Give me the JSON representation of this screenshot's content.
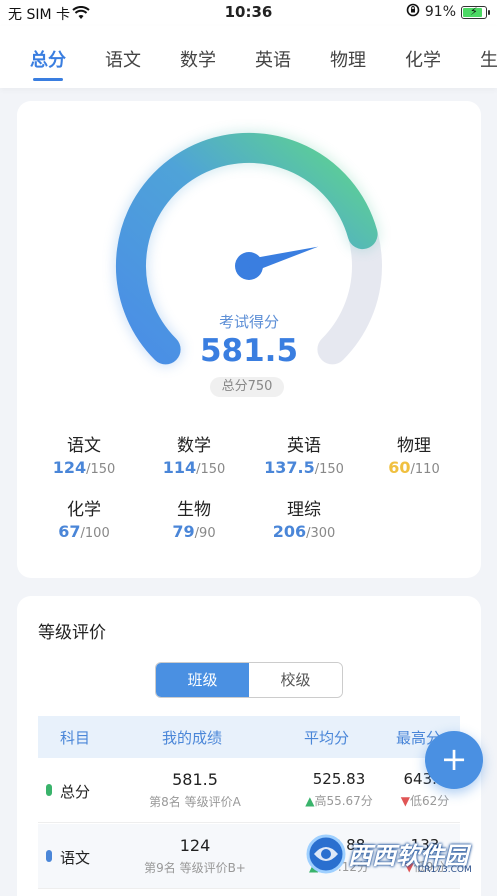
{
  "status_bar": {
    "carrier": "无 SIM 卡",
    "time": "10:36",
    "battery": "91%",
    "icons": [
      "wifi-icon",
      "orientation-lock-icon",
      "battery-icon"
    ]
  },
  "tabs": [
    {
      "label": "总分",
      "active": true
    },
    {
      "label": "语文",
      "active": false
    },
    {
      "label": "数学",
      "active": false
    },
    {
      "label": "英语",
      "active": false
    },
    {
      "label": "物理",
      "active": false
    },
    {
      "label": "化学",
      "active": false
    },
    {
      "label": "生",
      "active": false
    }
  ],
  "score_card": {
    "gauge_title": "考试得分",
    "score": "581.5",
    "score_value": 581.5,
    "total": "总分750",
    "total_value": 750,
    "subjects": [
      {
        "name": "语文",
        "score": "124",
        "max": "/150"
      },
      {
        "name": "数学",
        "score": "114",
        "max": "/150"
      },
      {
        "name": "英语",
        "score": "137.5",
        "max": "/150"
      },
      {
        "name": "物理",
        "score": "60",
        "max": "/110"
      },
      {
        "name": "化学",
        "score": "67",
        "max": "/100"
      },
      {
        "name": "生物",
        "score": "79",
        "max": "/90"
      },
      {
        "name": "理综",
        "score": "206",
        "max": "/300"
      }
    ]
  },
  "grade_card": {
    "title": "等级评价",
    "segments": [
      {
        "label": "班级",
        "active": true
      },
      {
        "label": "校级",
        "active": false
      }
    ],
    "columns": [
      "科目",
      "我的成绩",
      "平均分",
      "最高分"
    ],
    "rows": [
      {
        "subject": "总分",
        "score": "581.5",
        "rank": "第8名 等级评价A",
        "avg": "525.83",
        "avg_delta": "高55.67分",
        "max": "643.5",
        "max_delta": "低62分"
      },
      {
        "subject": "语文",
        "score": "124",
        "rank": "第9名 等级评价B+",
        "avg": "118.88",
        "avg_delta": "高5.12分",
        "max": "133",
        "max_delta": "低9分"
      }
    ]
  },
  "fab_label": "+",
  "watermark": {
    "text": "西西软件园",
    "url": "CR173.COM"
  },
  "colors": {
    "accent": "#3a7ee0",
    "gauge_start": "#4a8ee6",
    "gauge_end": "#5fd68a",
    "gauge_track": "#e6e8f0",
    "warn": "#f0c040"
  }
}
